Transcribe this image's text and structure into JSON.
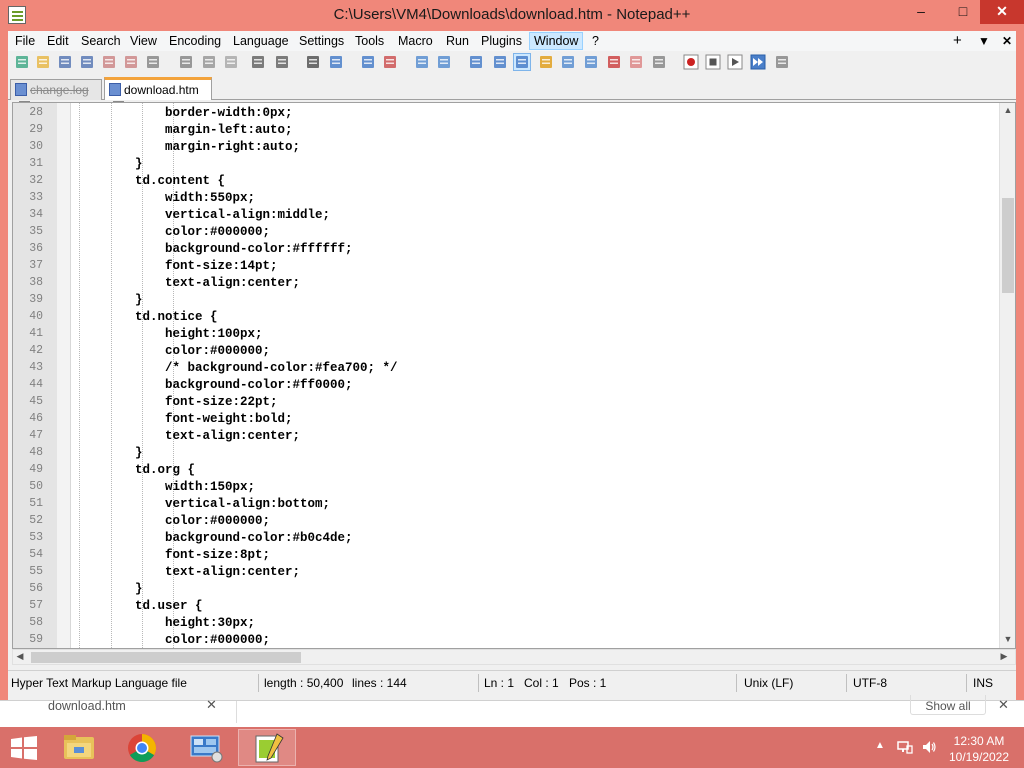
{
  "window": {
    "title": "C:\\Users\\VM4\\Downloads\\download.htm - Notepad++",
    "minimize": "–",
    "maximize": "□",
    "close": "✕"
  },
  "menu": {
    "items": [
      "File",
      "Edit",
      "Search",
      "View",
      "Encoding",
      "Language",
      "Settings",
      "Tools",
      "Macro",
      "Run",
      "Plugins",
      "Window",
      "?"
    ],
    "active": "Window",
    "right": {
      "plus": "+",
      "dropdown": "▼",
      "close": "✕"
    }
  },
  "toolbar": {
    "icons": [
      "new-file-icon",
      "open-file-icon",
      "save-icon",
      "save-all-icon",
      "close-icon",
      "close-all-icon",
      "print-icon",
      "cut-icon",
      "copy-icon",
      "paste-icon",
      "undo-icon",
      "redo-icon",
      "find-icon",
      "replace-icon",
      "zoom-in-icon",
      "zoom-out-icon",
      "sync-vertical-icon",
      "sync-horizontal-icon",
      "word-wrap-icon",
      "show-all-chars-icon",
      "indent-guide-icon",
      "user-language-icon",
      "doc-map-icon",
      "function-list-icon",
      "folder-workspace-icon",
      "doc-switcher-icon",
      "monitoring-icon",
      "record-macro-icon",
      "stop-record-icon",
      "play-macro-icon",
      "run-macro-multiple-icon",
      "save-macro-icon"
    ]
  },
  "tabs": [
    {
      "label": "change.log",
      "active": false
    },
    {
      "label": "download.htm",
      "active": true
    }
  ],
  "editor": {
    "lines": [
      {
        "n": "28",
        "code": "            border-width:0px;"
      },
      {
        "n": "29",
        "code": "            margin-left:auto;"
      },
      {
        "n": "30",
        "code": "            margin-right:auto;"
      },
      {
        "n": "31",
        "code": "        }"
      },
      {
        "n": "32",
        "code": "        td.content {"
      },
      {
        "n": "33",
        "code": "            width:550px;"
      },
      {
        "n": "34",
        "code": "            vertical-align:middle;"
      },
      {
        "n": "35",
        "code": "            color:#000000;"
      },
      {
        "n": "36",
        "code": "            background-color:#ffffff;"
      },
      {
        "n": "37",
        "code": "            font-size:14pt;"
      },
      {
        "n": "38",
        "code": "            text-align:center;"
      },
      {
        "n": "39",
        "code": "        }"
      },
      {
        "n": "40",
        "code": "        td.notice {"
      },
      {
        "n": "41",
        "code": "            height:100px;"
      },
      {
        "n": "42",
        "code": "            color:#000000;"
      },
      {
        "n": "43",
        "code": "            /* background-color:#fea700; */"
      },
      {
        "n": "44",
        "code": "            background-color:#ff0000;"
      },
      {
        "n": "45",
        "code": "            font-size:22pt;"
      },
      {
        "n": "46",
        "code": "            font-weight:bold;"
      },
      {
        "n": "47",
        "code": "            text-align:center;"
      },
      {
        "n": "48",
        "code": "        }"
      },
      {
        "n": "49",
        "code": "        td.org {"
      },
      {
        "n": "50",
        "code": "            width:150px;"
      },
      {
        "n": "51",
        "code": "            vertical-align:bottom;"
      },
      {
        "n": "52",
        "code": "            color:#000000;"
      },
      {
        "n": "53",
        "code": "            background-color:#b0c4de;"
      },
      {
        "n": "54",
        "code": "            font-size:8pt;"
      },
      {
        "n": "55",
        "code": "            text-align:center;"
      },
      {
        "n": "56",
        "code": "        }"
      },
      {
        "n": "57",
        "code": "        td.user {"
      },
      {
        "n": "58",
        "code": "            height:30px;"
      },
      {
        "n": "59",
        "code": "            color:#000000;"
      }
    ]
  },
  "statusbar": {
    "filetype": "Hyper Text Markup Language file",
    "length": "length : 50,400",
    "lines": "lines : 144",
    "ln": "Ln : 1",
    "col": "Col : 1",
    "pos": "Pos : 1",
    "eol": "Unix (LF)",
    "encoding": "UTF-8",
    "mode": "INS"
  },
  "downloadbar": {
    "file": "download.htm",
    "show_all": "Show all",
    "close": "✕"
  },
  "taskbar": {
    "apps": [
      "file-explorer-icon",
      "chrome-icon",
      "control-panel-icon",
      "notepad-plus-plus-icon"
    ],
    "clock_time": "12:30 AM",
    "clock_date": "10/19/2022"
  },
  "colors": {
    "titlebar": "#f0877a",
    "close_button": "#c8372d",
    "active_tab_accent": "#f3a33c",
    "taskbar": "#d9706a"
  }
}
